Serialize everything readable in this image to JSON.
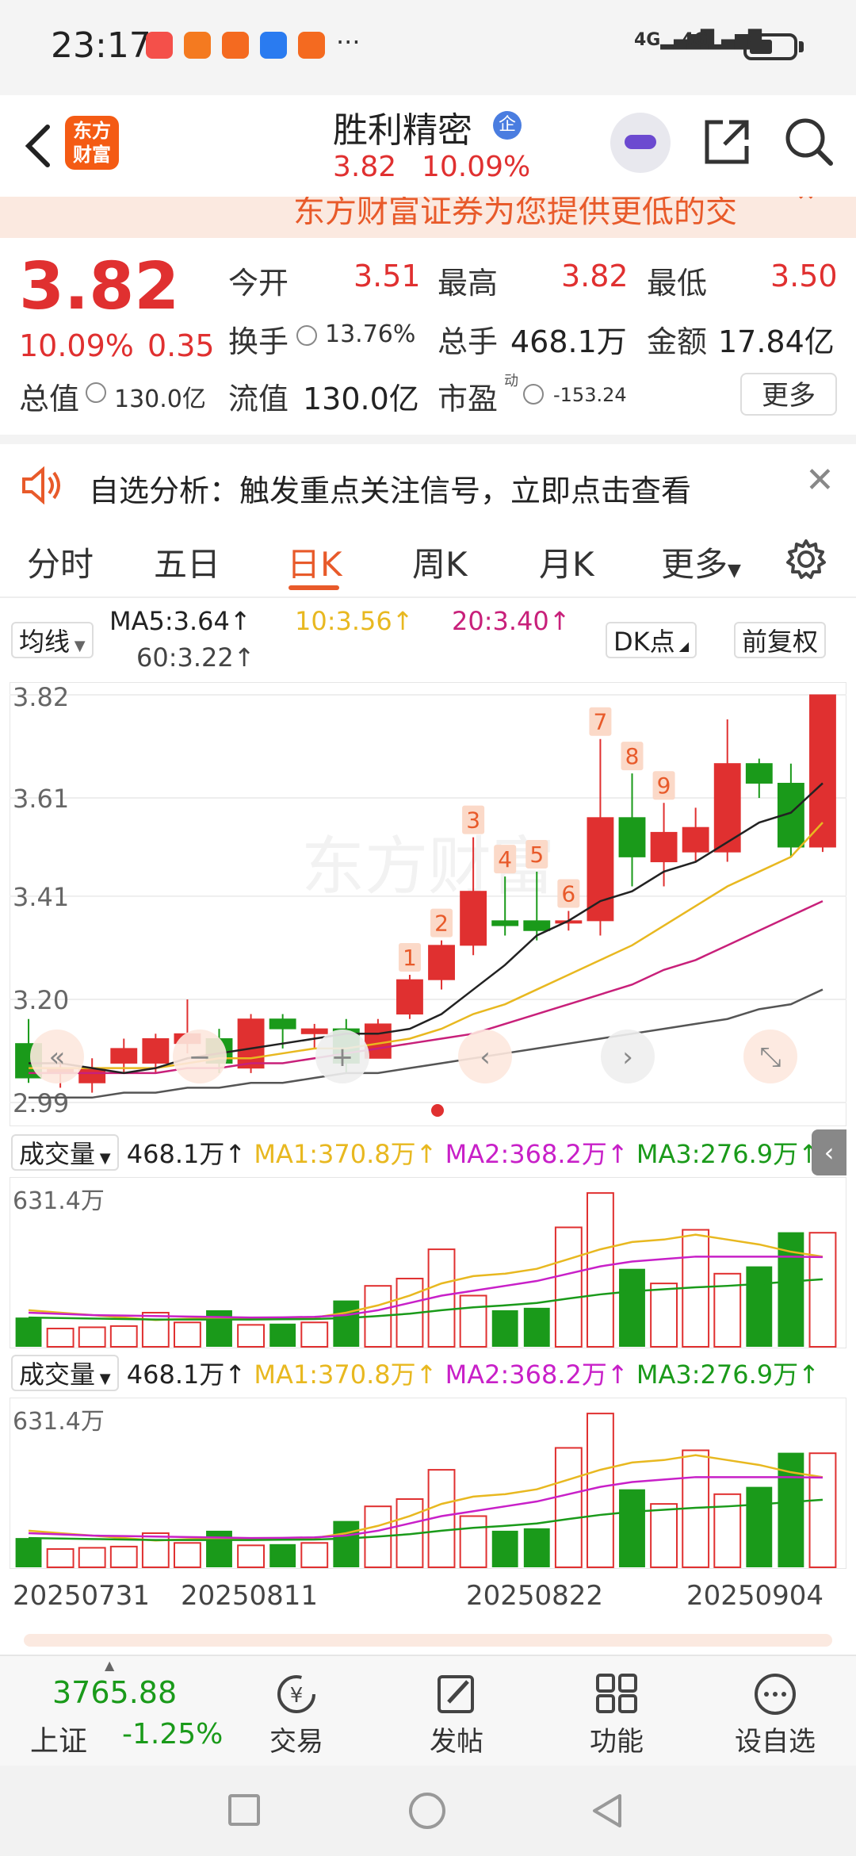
{
  "status_bar": {
    "time": "23:17",
    "network1": "4G",
    "network2": "4G",
    "more": "···",
    "app_colors": [
      "#f4504a",
      "#f47a20",
      "#f46a20",
      "#2a7bf0",
      "#f46a20"
    ]
  },
  "header": {
    "logo_line1": "东方",
    "logo_line2": "财富",
    "stock_name": "胜利精密",
    "badge": "企",
    "price": "3.82",
    "change_pct": "10.09%"
  },
  "banner": {
    "text": "东方财富证券为您提供更低的交"
  },
  "quote": {
    "price": "3.82",
    "change_pct": "10.09%",
    "change_amt": "0.35",
    "open_label": "今开",
    "open": "3.51",
    "high_label": "最高",
    "high": "3.82",
    "low_label": "最低",
    "low": "3.50",
    "turnover_label": "换手",
    "turnover": "13.76%",
    "volume_label": "总手",
    "volume": "468.1万",
    "amount_label": "金额",
    "amount": "17.84亿",
    "mcap_label": "总值",
    "mcap": "130.0亿",
    "float_label": "流值",
    "float_val": "130.0亿",
    "pe_label": "市盈",
    "pe_sup": "动",
    "pe": "-153.24",
    "more_label": "更多"
  },
  "notice": {
    "text": "自选分析：触发重点关注信号，立即点击查看"
  },
  "tabs": [
    "分时",
    "五日",
    "日K",
    "周K",
    "月K",
    "更多"
  ],
  "ma_row": {
    "selector": "均线",
    "ma5": "MA5:3.64↑",
    "ma10": "10:3.56↑",
    "ma20": "20:3.40↑",
    "ma60": "60:3.22↑",
    "dk_label": "DK点",
    "adjust_label": "前复权"
  },
  "colors": {
    "up": "#e03030",
    "down": "#1a9a1a",
    "ma5": "#222222",
    "ma10": "#e8b820",
    "ma20": "#c8207a",
    "ma60": "#555555",
    "accent": "#e85a2a"
  },
  "chart_data": {
    "type": "candlestick",
    "y_ticks": [
      "3.82",
      "3.61",
      "3.41",
      "3.20",
      "2.99"
    ],
    "ylim": [
      2.99,
      3.82
    ],
    "candles": [
      {
        "o": 3.11,
        "c": 3.04,
        "h": 3.16,
        "l": 3.03
      },
      {
        "o": 3.05,
        "c": 3.06,
        "h": 3.09,
        "l": 3.02
      },
      {
        "o": 3.03,
        "c": 3.06,
        "h": 3.08,
        "l": 3.01
      },
      {
        "o": 3.07,
        "c": 3.1,
        "h": 3.12,
        "l": 3.05
      },
      {
        "o": 3.07,
        "c": 3.12,
        "h": 3.13,
        "l": 3.05
      },
      {
        "o": 3.11,
        "c": 3.13,
        "h": 3.2,
        "l": 3.09
      },
      {
        "o": 3.12,
        "c": 3.07,
        "h": 3.14,
        "l": 3.05
      },
      {
        "o": 3.06,
        "c": 3.16,
        "h": 3.17,
        "l": 3.05
      },
      {
        "o": 3.16,
        "c": 3.14,
        "h": 3.17,
        "l": 3.1
      },
      {
        "o": 3.13,
        "c": 3.14,
        "h": 3.15,
        "l": 3.1
      },
      {
        "o": 3.14,
        "c": 3.07,
        "h": 3.16,
        "l": 3.05
      },
      {
        "o": 3.08,
        "c": 3.15,
        "h": 3.16,
        "l": 3.08
      },
      {
        "o": 3.17,
        "c": 3.24,
        "h": 3.25,
        "l": 3.16
      },
      {
        "o": 3.24,
        "c": 3.31,
        "h": 3.32,
        "l": 3.22
      },
      {
        "o": 3.31,
        "c": 3.42,
        "h": 3.53,
        "l": 3.29
      },
      {
        "o": 3.36,
        "c": 3.35,
        "h": 3.45,
        "l": 3.33
      },
      {
        "o": 3.36,
        "c": 3.34,
        "h": 3.46,
        "l": 3.32
      },
      {
        "o": 3.36,
        "c": 3.36,
        "h": 3.38,
        "l": 3.34
      },
      {
        "o": 3.36,
        "c": 3.57,
        "h": 3.73,
        "l": 3.33
      },
      {
        "o": 3.57,
        "c": 3.49,
        "h": 3.66,
        "l": 3.43
      },
      {
        "o": 3.48,
        "c": 3.54,
        "h": 3.6,
        "l": 3.43
      },
      {
        "o": 3.5,
        "c": 3.55,
        "h": 3.59,
        "l": 3.48
      },
      {
        "o": 3.5,
        "c": 3.68,
        "h": 3.77,
        "l": 3.48
      },
      {
        "o": 3.68,
        "c": 3.64,
        "h": 3.69,
        "l": 3.61
      },
      {
        "o": 3.64,
        "c": 3.51,
        "h": 3.68,
        "l": 3.49
      },
      {
        "o": 3.51,
        "c": 3.82,
        "h": 3.82,
        "l": 3.5
      }
    ],
    "ma5": [
      3.07,
      3.07,
      3.06,
      3.05,
      3.06,
      3.08,
      3.09,
      3.1,
      3.11,
      3.12,
      3.13,
      3.13,
      3.14,
      3.17,
      3.22,
      3.27,
      3.33,
      3.36,
      3.4,
      3.42,
      3.46,
      3.48,
      3.52,
      3.56,
      3.58,
      3.64
    ],
    "ma10": [
      3.06,
      3.06,
      3.06,
      3.06,
      3.06,
      3.07,
      3.08,
      3.08,
      3.09,
      3.1,
      3.1,
      3.11,
      3.12,
      3.14,
      3.17,
      3.19,
      3.22,
      3.25,
      3.28,
      3.31,
      3.35,
      3.39,
      3.43,
      3.46,
      3.49,
      3.56
    ],
    "ma20": [
      3.05,
      3.05,
      3.05,
      3.05,
      3.05,
      3.06,
      3.06,
      3.07,
      3.07,
      3.08,
      3.09,
      3.1,
      3.11,
      3.12,
      3.13,
      3.15,
      3.17,
      3.19,
      3.21,
      3.23,
      3.26,
      3.28,
      3.31,
      3.34,
      3.37,
      3.4
    ],
    "ma60": [
      3.0,
      3.0,
      3.0,
      3.01,
      3.01,
      3.02,
      3.02,
      3.03,
      3.03,
      3.04,
      3.05,
      3.05,
      3.06,
      3.07,
      3.08,
      3.09,
      3.1,
      3.11,
      3.12,
      3.13,
      3.14,
      3.15,
      3.16,
      3.18,
      3.19,
      3.22
    ],
    "markers": [
      {
        "label": "1",
        "index": 12
      },
      {
        "label": "2",
        "index": 13
      },
      {
        "label": "3",
        "index": 14
      },
      {
        "label": "4",
        "index": 15
      },
      {
        "label": "5",
        "index": 16
      },
      {
        "label": "6",
        "index": 17
      },
      {
        "label": "7",
        "index": 18
      },
      {
        "label": "8",
        "index": 19
      },
      {
        "label": "9",
        "index": 20
      }
    ],
    "volume": {
      "max_label": "631.4万",
      "values": [
        120,
        75,
        80,
        85,
        140,
        100,
        150,
        90,
        95,
        100,
        190,
        250,
        280,
        400,
        210,
        150,
        160,
        490,
        631,
        320,
        260,
        480,
        300,
        330,
        470,
        468
      ],
      "ma1": [
        150,
        140,
        130,
        120,
        110,
        115,
        120,
        118,
        116,
        120,
        140,
        170,
        210,
        260,
        290,
        300,
        320,
        360,
        400,
        430,
        440,
        460,
        440,
        420,
        390,
        370
      ],
      "ma2": [
        140,
        135,
        130,
        128,
        126,
        124,
        122,
        120,
        121,
        123,
        130,
        150,
        180,
        210,
        230,
        250,
        270,
        300,
        330,
        350,
        360,
        370,
        370,
        370,
        370,
        368
      ],
      "ma3": [
        120,
        118,
        116,
        114,
        112,
        112,
        112,
        112,
        113,
        114,
        118,
        126,
        136,
        150,
        162,
        170,
        180,
        198,
        215,
        228,
        236,
        244,
        250,
        258,
        268,
        277
      ],
      "vol_label": "成交量",
      "vol_value": "468.1万↑",
      "ma1_label": "MA1:370.8万↑",
      "ma2_label": "MA2:368.2万↑",
      "ma3_label": "MA3:276.9万↑"
    },
    "dates": [
      "20250731",
      "20250811",
      "20250822",
      "20250904"
    ]
  },
  "bottom_nav": {
    "index_value": "3765.88",
    "index_name": "上证",
    "index_change": "-1.25%",
    "items": [
      "交易",
      "发帖",
      "功能",
      "设自选"
    ]
  },
  "watermark": "东方财富"
}
